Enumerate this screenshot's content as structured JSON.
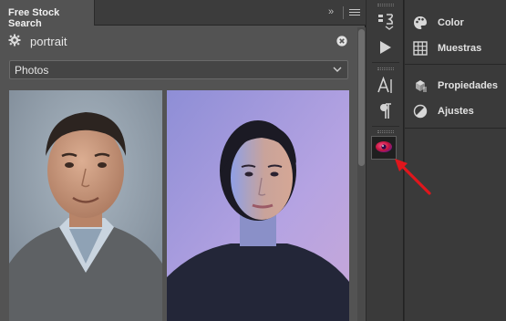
{
  "panel": {
    "tab_label": "Free Stock Search",
    "collapse_label": "»",
    "search": {
      "value": "portrait"
    },
    "filter": {
      "selected": "Photos"
    },
    "results": [
      {
        "name": "man-portrait"
      },
      {
        "name": "woman-portrait"
      }
    ]
  },
  "tools": [
    "paragraph-styles-icon",
    "play-icon",
    "character-icon",
    "paragraph-icon",
    "extension-icon"
  ],
  "right_panel": {
    "items": [
      {
        "label": "Color",
        "icon": "palette-icon"
      },
      {
        "label": "Muestras",
        "icon": "grid-icon"
      },
      {
        "label": "Propiedades",
        "icon": "properties-icon"
      },
      {
        "label": "Ajustes",
        "icon": "adjustments-icon"
      }
    ]
  },
  "colors": {
    "accent_arrow": "#e0161c",
    "panel_bg": "#535353",
    "dock_bg": "#3a3a3a"
  }
}
